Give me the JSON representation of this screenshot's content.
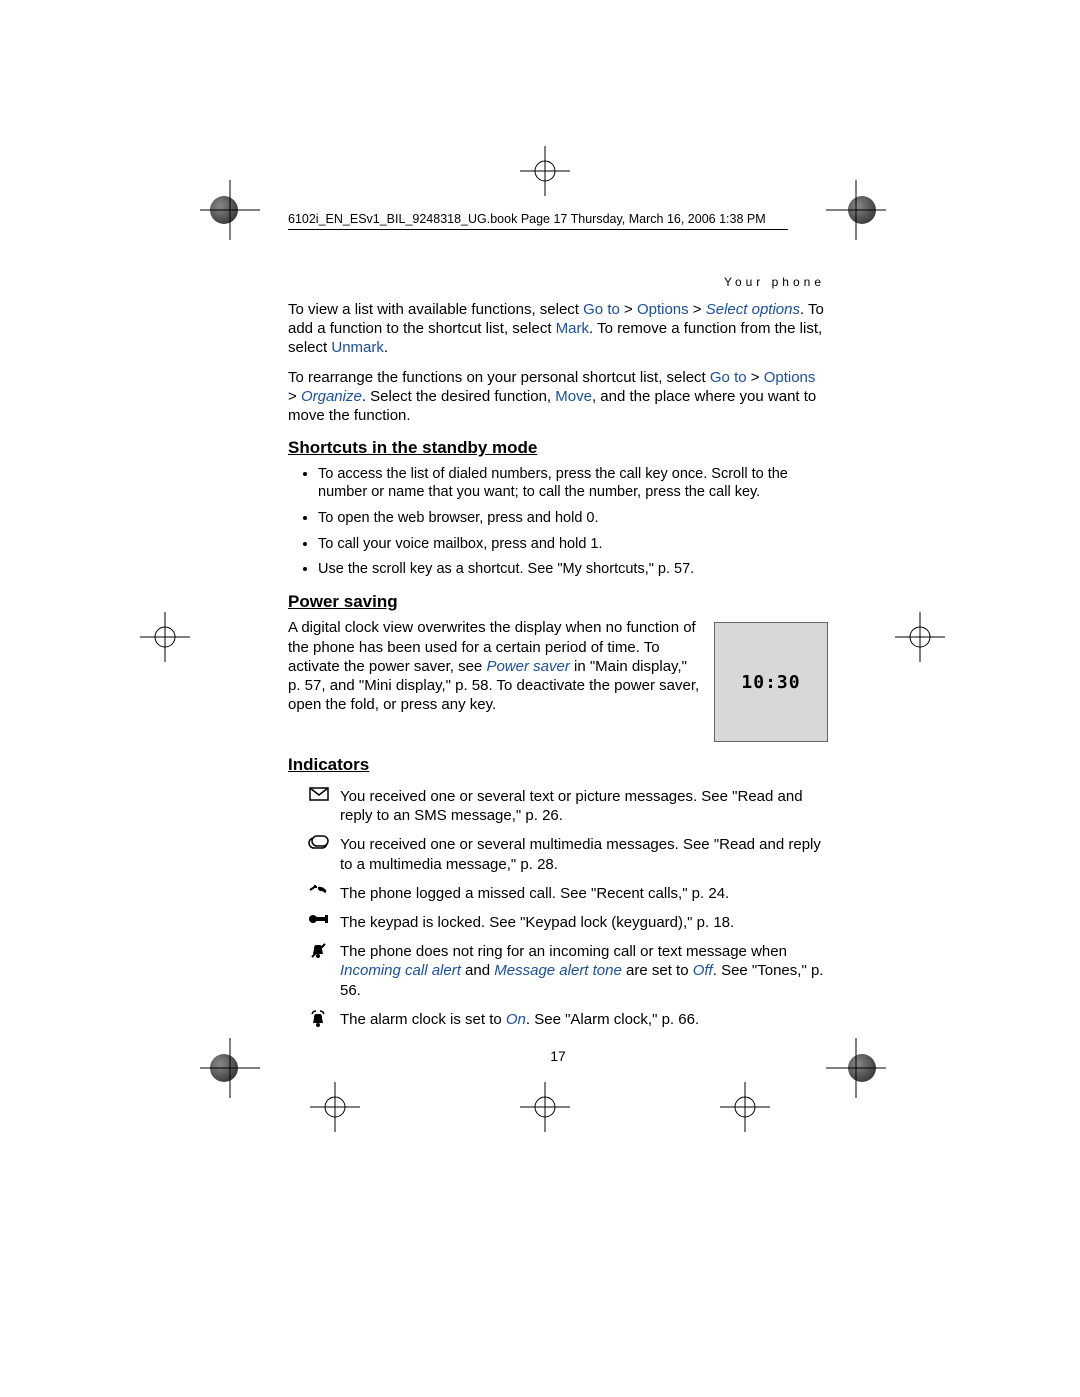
{
  "header": {
    "book_line": "6102i_EN_ESv1_BIL_9248318_UG.book  Page 17  Thursday, March 16, 2006  1:38 PM",
    "section": "Your phone"
  },
  "intro": {
    "p1_a": "To view a list with available functions, select ",
    "p1_goto": "Go to",
    "p1_gt": " > ",
    "p1_options": "Options",
    "p1_gt2": " > ",
    "p1_select_options": "Select options",
    "p1_b": ". To add a function to the shortcut list, select ",
    "p1_mark": "Mark",
    "p1_c": ". To remove a function from the list, select ",
    "p1_unmark": "Unmark",
    "p1_d": ".",
    "p2_a": "To rearrange the functions on your personal shortcut list, select ",
    "p2_goto": "Go to",
    "p2_gt": " > ",
    "p2_options": "Options",
    "p2_gt2": " > ",
    "p2_organize": "Organize",
    "p2_b": ". Select the desired function, ",
    "p2_move": "Move",
    "p2_c": ", and the place where you want to move the function."
  },
  "shortcuts": {
    "heading": "Shortcuts in the standby mode",
    "items": [
      "To access the list of dialed numbers, press the call key once. Scroll to the number or name that you want; to call the number, press the call key.",
      "To open the web browser, press and hold 0.",
      "To call your voice mailbox, press and hold 1.",
      "Use the scroll key as a shortcut. See \"My shortcuts,\" p. 57."
    ]
  },
  "power": {
    "heading": "Power saving",
    "text_a": "A digital clock view overwrites the display when no function of the phone has been used for a certain period of time. To activate the power saver, see ",
    "link": "Power saver",
    "text_b": " in \"Main display,\" p. 57, and \"Mini display,\" p. 58. To deactivate the power saver, open the fold, or press any key.",
    "clock": "10:30"
  },
  "indicators": {
    "heading": "Indicators",
    "rows": [
      {
        "icon": "envelope",
        "text_a": "You received one or several text or picture messages. See \"Read and reply to an SMS message,\" p. 26."
      },
      {
        "icon": "mms",
        "text_a": "You received one or several multimedia messages. See \"Read and reply to a multimedia message,\" p. 28."
      },
      {
        "icon": "missed-call",
        "text_a": "The phone logged a missed call. See \"Recent calls,\" p. 24."
      },
      {
        "icon": "lock",
        "text_a": "The keypad is locked. See \"Keypad lock (keyguard),\" p. 18."
      },
      {
        "icon": "silent",
        "text_a": "The phone does not ring for an incoming call or text message when ",
        "link1": "Incoming call alert",
        "mid": " and ",
        "link2": "Message alert tone",
        "mid2": " are set to ",
        "link3": "Off",
        "text_b": ". See \"Tones,\" p. 56."
      },
      {
        "icon": "alarm",
        "text_a": "The alarm clock is set to ",
        "link1": "On",
        "text_b": ". See \"Alarm clock,\" p. 66."
      }
    ]
  },
  "page_number": "17"
}
